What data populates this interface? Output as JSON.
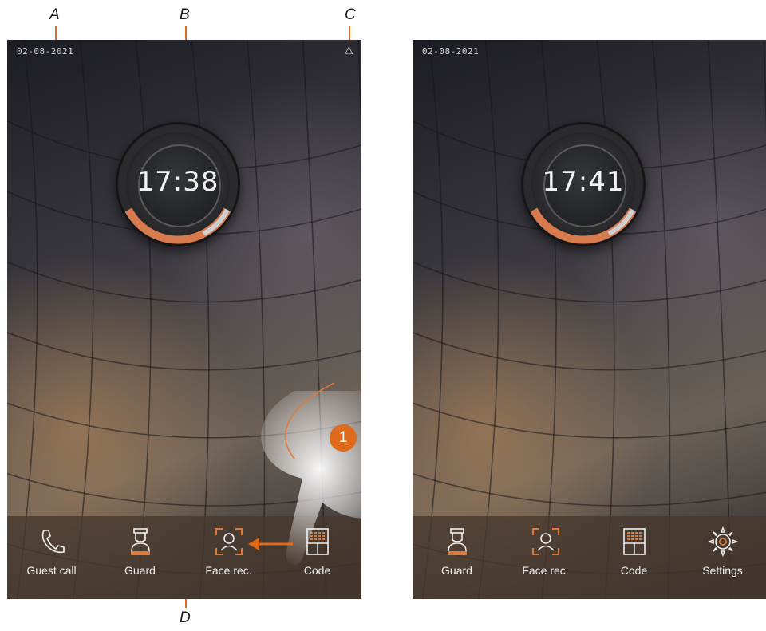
{
  "callouts": {
    "a": "A",
    "b": "B",
    "c": "C",
    "d": "D"
  },
  "screen_before": {
    "date": "02-08-2021",
    "warning_icon": "warning-triangle-icon",
    "clock_time": "17:38",
    "dock": [
      {
        "label": "Guest call",
        "icon": "phone-handset-icon"
      },
      {
        "label": "Guard",
        "icon": "guard-icon"
      },
      {
        "label": "Face rec.",
        "icon": "face-recognition-icon"
      },
      {
        "label": "Code",
        "icon": "keypad-icon"
      }
    ],
    "step_number": "1"
  },
  "screen_after": {
    "date": "02-08-2021",
    "clock_time": "17:41",
    "dock": [
      {
        "label": "Guard",
        "icon": "guard-icon"
      },
      {
        "label": "Face rec.",
        "icon": "face-recognition-icon"
      },
      {
        "label": "Code",
        "icon": "keypad-icon"
      },
      {
        "label": "Settings",
        "icon": "gear-icon"
      }
    ]
  },
  "colors": {
    "accent": "#e06a1b",
    "dock_bg": "#46372d",
    "text": "#eeeeee"
  }
}
